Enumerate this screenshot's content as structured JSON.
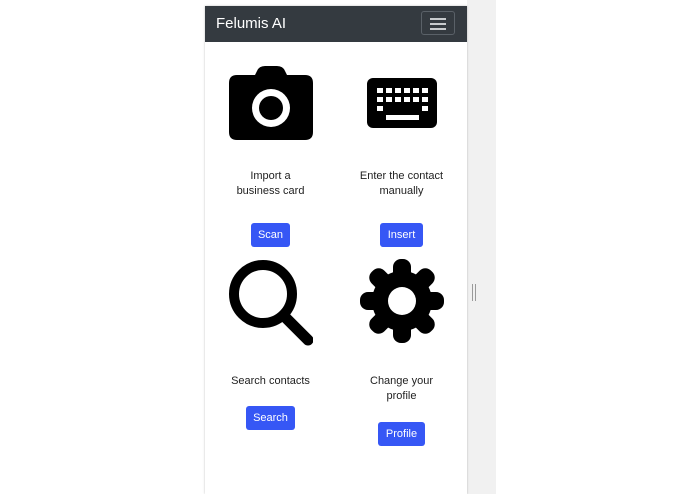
{
  "navbar": {
    "brand": "Felumis AI",
    "menu_icon": "hamburger-icon"
  },
  "cards": [
    {
      "icon": "camera-icon",
      "caption_lines": [
        "Import a",
        "business card"
      ],
      "button": "Scan"
    },
    {
      "icon": "keyboard-icon",
      "caption_lines": [
        "Enter the contact",
        "manually"
      ],
      "button": "Insert"
    },
    {
      "icon": "search-icon",
      "caption_lines": [
        "Search contacts"
      ],
      "button": "Search"
    },
    {
      "icon": "gear-icon",
      "caption_lines": [
        "Change your",
        "profile"
      ],
      "button": "Profile"
    }
  ],
  "colors": {
    "navbar_bg": "#343a40",
    "button_bg": "#3657f5",
    "icon": "#000000"
  }
}
